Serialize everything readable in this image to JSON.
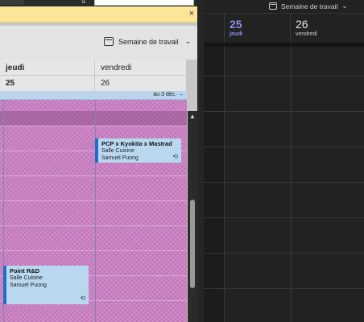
{
  "left_panel": {
    "view_selector": {
      "label": "Semaine de travail"
    },
    "notification": {
      "close": "×"
    },
    "days": [
      {
        "name": "jeudi",
        "date": "25"
      },
      {
        "name": "vendredi",
        "date": "26"
      }
    ],
    "allday_banner": "au 3 déc. →",
    "events": [
      {
        "title": "PCP x Kyokita x Mastrad",
        "location": "Salle Cuisine",
        "organizer": "Samuel Puong"
      },
      {
        "title": "Point R&D",
        "location": "Salle Cuisine",
        "organizer": "Samuel Puong"
      }
    ],
    "scroll_up": "▲"
  },
  "right_panel": {
    "view_selector": {
      "label": "Semaine de travail"
    },
    "days": [
      {
        "date": "25",
        "name": "jeudi"
      },
      {
        "date": "26",
        "name": "vendredi"
      }
    ]
  },
  "colors": {
    "event_accent": "#1f6fc4",
    "event_fill": "#b9d8ef",
    "busy_pattern": "#cf8ac8",
    "today_accent": "#8c8fe8",
    "notification_bg": "#fde59a"
  },
  "icons": {
    "calendar": "calendar-view-icon",
    "chevron": "chevron-down-icon",
    "recurring": "recurring-icon",
    "close": "close-icon",
    "arrow": "arrow-right-icon"
  }
}
